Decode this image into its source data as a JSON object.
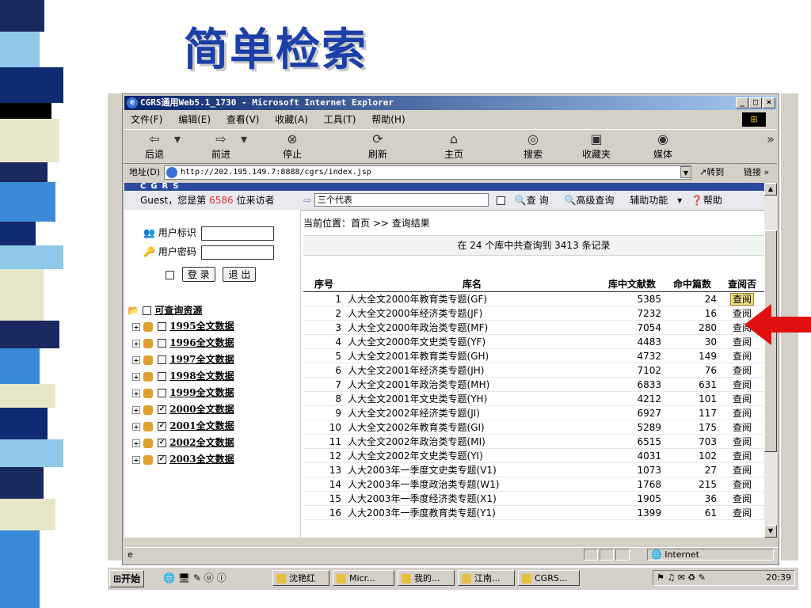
{
  "slide": {
    "title": "简单检索"
  },
  "window": {
    "title": "CGRS通用Web5.1_1730 - Microsoft Internet Explorer",
    "menu": [
      "文件(F)",
      "编辑(E)",
      "查看(V)",
      "收藏(A)",
      "工具(T)",
      "帮助(H)"
    ],
    "toolbar": {
      "back": "后退",
      "forward": "前进",
      "stop": "停止",
      "refresh": "刷新",
      "home": "主页",
      "search": "搜索",
      "favorites": "收藏夹",
      "media": "媒体"
    },
    "address_label": "地址(D)",
    "address": "http://202.195.149.7:8888/cgrs/index.jsp",
    "go": "转到",
    "links": "链接",
    "status_zone": "Internet"
  },
  "site": {
    "banner": "CGRS",
    "visitor_prefix": "Guest，您是第",
    "visitor_num": "6586",
    "visitor_suffix": "位来访者",
    "search_value": "三个代表",
    "nav_search": "查 询",
    "nav_advanced": "高级查询",
    "nav_aux": "辅助功能",
    "nav_help": "帮助",
    "user_label": "用户标识",
    "pass_label": "用户密码",
    "login_btn": "登 录",
    "logout_btn": "退 出",
    "tree_title": "可查询资源",
    "tree_items": [
      "1995全文数据",
      "1996全文数据",
      "1997全文数据",
      "1998全文数据",
      "1999全文数据",
      "2000全文数据",
      "2001全文数据",
      "2002全文数据",
      "2003全文数据"
    ],
    "breadcrumb": "当前位置：首页 >> 查询结果",
    "summary": "在 24 个库中共查询到 3413 条记录",
    "table": {
      "headers": [
        "序号",
        "库名",
        "库中文献数",
        "命中篇数",
        "查阅否"
      ],
      "view_label": "查阅",
      "rows": [
        [
          "1",
          "人大全文2000年教育类专题(GF)",
          "5385",
          "24"
        ],
        [
          "2",
          "人大全文2000年经济类专题(JF)",
          "7232",
          "16"
        ],
        [
          "3",
          "人大全文2000年政治类专题(MF)",
          "7054",
          "280"
        ],
        [
          "4",
          "人大全文2000年文史类专题(YF)",
          "4483",
          "30"
        ],
        [
          "5",
          "人大全文2001年教育类专题(GH)",
          "4732",
          "149"
        ],
        [
          "6",
          "人大全文2001年经济类专题(JH)",
          "7102",
          "76"
        ],
        [
          "7",
          "人大全文2001年政治类专题(MH)",
          "6833",
          "631"
        ],
        [
          "8",
          "人大全文2001年文史类专题(YH)",
          "4212",
          "101"
        ],
        [
          "9",
          "人大全文2002年经济类专题(JI)",
          "6927",
          "117"
        ],
        [
          "10",
          "人大全文2002年教育类专题(GI)",
          "5289",
          "175"
        ],
        [
          "11",
          "人大全文2002年政治类专题(MI)",
          "6515",
          "703"
        ],
        [
          "12",
          "人大全文2002年文史类专题(YI)",
          "4031",
          "102"
        ],
        [
          "13",
          "人大2003年一季度文史类专题(V1)",
          "1073",
          "27"
        ],
        [
          "14",
          "人大2003年一季度政治类专题(W1)",
          "1768",
          "215"
        ],
        [
          "15",
          "人大2003年一季度经济类专题(X1)",
          "1905",
          "36"
        ],
        [
          "16",
          "人大2003年一季度教育类专题(Y1)",
          "1399",
          "61"
        ]
      ]
    }
  },
  "taskbar": {
    "start": "开始",
    "tasks": [
      "沈艳红",
      "Micr...",
      "我的...",
      "江南...",
      "CGRS..."
    ],
    "clock": "20:39"
  },
  "colors": {
    "title": "#1a3fa8",
    "titlebar": "#0a246a",
    "arrow": "#e01010",
    "visitor_num": "#e03030"
  }
}
